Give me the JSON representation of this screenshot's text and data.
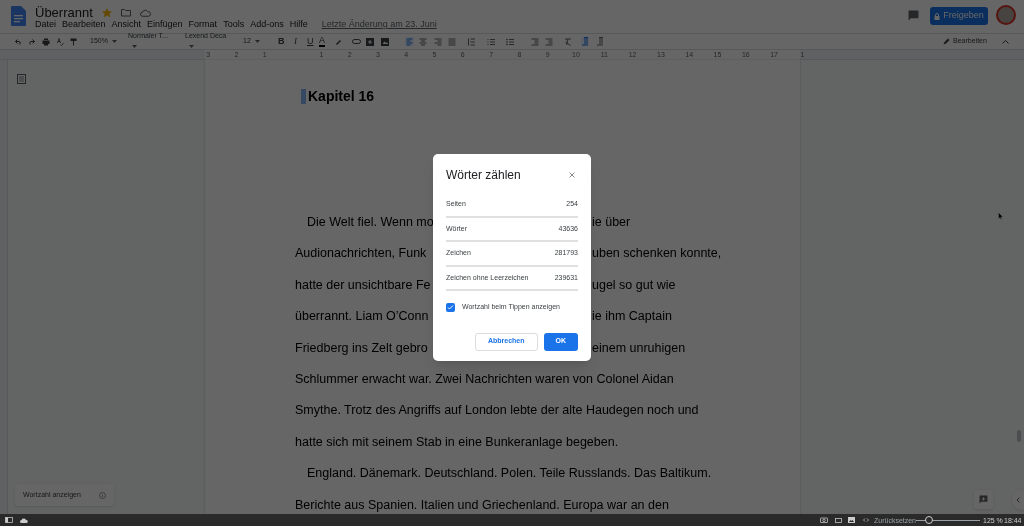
{
  "document": {
    "title": "Überrannt",
    "starred": true,
    "last_edit": "Letzte Änderung am 23. Juni"
  },
  "menu": [
    "Datei",
    "Bearbeiten",
    "Ansicht",
    "Einfügen",
    "Format",
    "Tools",
    "Add-ons",
    "Hilfe"
  ],
  "share_button": "Freigeben",
  "toolbar": {
    "format": [
      "B",
      "I",
      "U",
      "A"
    ],
    "zoom": "150%",
    "style": "Normaler T...",
    "font": "Lexend Deca",
    "size": "12",
    "mode": "Bearbeiten"
  },
  "ruler": [
    "3",
    "2",
    "1",
    "1",
    "2",
    "3",
    "4",
    "5",
    "6",
    "7",
    "8",
    "9",
    "10",
    "11",
    "12",
    "13",
    "14",
    "15",
    "16",
    "17",
    "1"
  ],
  "page": {
    "heading": "Kapitel 16",
    "lines": [
      {
        "kind": "split",
        "indent": true,
        "left": "Die Welt fiel. Wenn mo",
        "right": "ie über"
      },
      {
        "kind": "split",
        "indent": false,
        "left": "Audionachrichten, Funk",
        "right": "uben schenken konnte,"
      },
      {
        "kind": "split",
        "indent": false,
        "left": "hatte der unsichtbare Fe",
        "right": "ugel so gut wie"
      },
      {
        "kind": "split",
        "indent": false,
        "left": "überrannt. Liam O’Conn",
        "right": "ie ihm Captain"
      },
      {
        "kind": "split",
        "indent": false,
        "left": "Friedberg ins Zelt gebro",
        "right": "einem unruhigen"
      },
      {
        "kind": "full",
        "indent": false,
        "text": "Schlummer erwacht war. Zwei Nachrichten waren von Colonel Aidan"
      },
      {
        "kind": "full",
        "indent": false,
        "text": "Smythe. Trotz des Angriffs auf London lebte der alte Haudegen noch und"
      },
      {
        "kind": "full",
        "indent": false,
        "text": "hatte sich mit seinem Stab in eine Bunkeranlage begeben."
      },
      {
        "kind": "full",
        "indent": true,
        "text": "England. Dänemark. Deutschland. Polen. Teile Russlands. Das Baltikum."
      },
      {
        "kind": "full",
        "indent": false,
        "text": "Berichte aus Spanien. Italien und Griechenland. Europa war an den"
      }
    ]
  },
  "word_count_chip": "Wortzahl anzeigen",
  "dialog": {
    "title": "Wörter zählen",
    "stats": [
      {
        "label": "Seiten",
        "value": "254"
      },
      {
        "label": "Wörter",
        "value": "43636"
      },
      {
        "label": "Zeichen",
        "value": "281793"
      },
      {
        "label": "Zeichen ohne Leerzeichen",
        "value": "239631"
      }
    ],
    "checkbox": {
      "label": "Wortzahl beim Tippen anzeigen",
      "checked": true
    },
    "buttons": [
      "Abbrechen",
      "OK"
    ]
  },
  "taskbar": {
    "reset": "Zurücksetzen",
    "zoom_slider": {
      "level": 0.2
    },
    "zoom": "125 %",
    "time": "18:44"
  }
}
